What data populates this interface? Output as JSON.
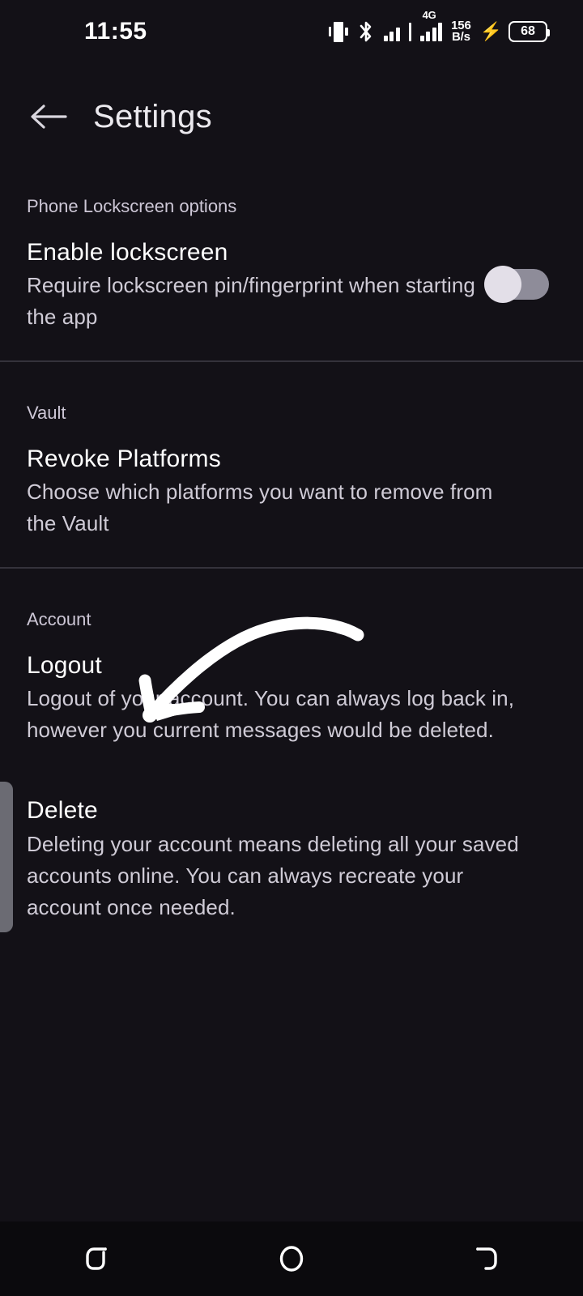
{
  "status_bar": {
    "time": "11:55",
    "vibrate_icon": "vibrate-icon",
    "bluetooth_icon": "bluetooth-icon",
    "signal_icon": "signal-bars-icon",
    "network_type": "4G",
    "network_speed_value": "156",
    "network_speed_unit": "B/s",
    "charging_icon": "charging-bolt-icon",
    "battery_level": "68"
  },
  "app_bar": {
    "back_icon": "back-arrow-icon",
    "title": "Settings"
  },
  "sections": [
    {
      "label": "Phone Lockscreen options",
      "items": [
        {
          "title": "Enable lockscreen",
          "subtitle": "Require lockscreen pin/fingerprint when starting the app",
          "control": "toggle",
          "toggle_state": "off"
        }
      ]
    },
    {
      "label": "Vault",
      "items": [
        {
          "title": "Revoke Platforms",
          "subtitle": "Choose which platforms you want to remove from the Vault"
        }
      ]
    },
    {
      "label": "Account",
      "items": [
        {
          "title": "Logout",
          "subtitle": "Logout of your account. You can always log back in, however you current messages would be deleted."
        },
        {
          "title": "Delete",
          "subtitle": "Deleting your account means deleting all your saved accounts online. You can always recreate your account once needed."
        }
      ]
    }
  ],
  "annotation": {
    "type": "curved-arrow",
    "points_to": "Logout",
    "color": "#ffffff"
  },
  "nav_bar": {
    "recents_icon": "recents-icon",
    "home_icon": "home-icon",
    "back_icon": "back-nav-icon"
  },
  "colors": {
    "background": "#131117",
    "nav_background": "#0b0a0d",
    "divider": "#34323b",
    "title_text": "#ffffff",
    "subtitle_text": "#cfcbd6",
    "section_label": "#cdc7d6",
    "toggle_track": "#8e8c99",
    "toggle_thumb": "#e3dfe8",
    "scrollbar": "#6b6b73"
  }
}
